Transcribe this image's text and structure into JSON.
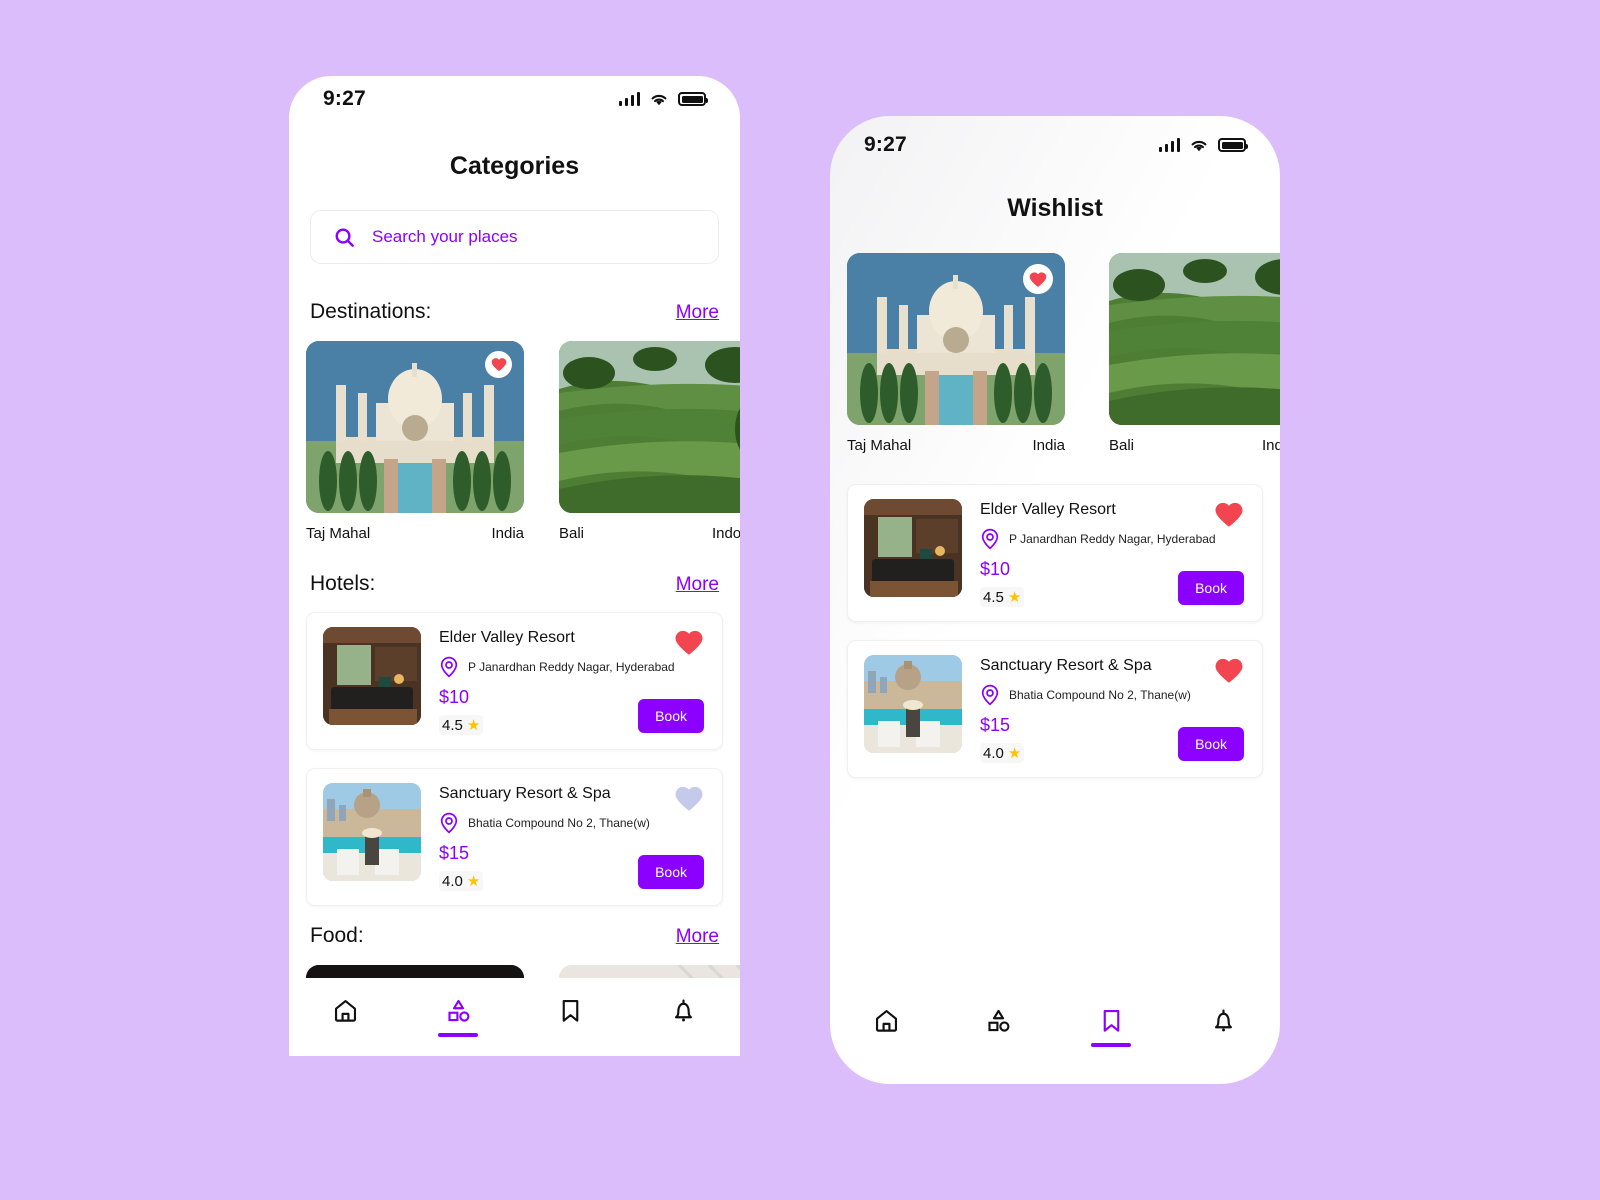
{
  "theme": {
    "background": "#dcbdfc",
    "accent": "#8b00ff",
    "heart_active": "#f2454f",
    "heart_inactive": "#c5c9ea",
    "star": "#ffc400",
    "text": "#111111"
  },
  "phone_left": {
    "status_bar": {
      "time": "9:27",
      "signal_icon": "signal-bars-icon",
      "wifi_icon": "wifi-icon",
      "battery_icon": "battery-icon"
    },
    "title": "Categories",
    "search": {
      "icon": "search-icon",
      "placeholder": "Search your places",
      "value": ""
    },
    "sections": [
      {
        "title": "Destinations:",
        "more_label": "More"
      },
      {
        "title": "Hotels:",
        "more_label": "More"
      },
      {
        "title": "Food:",
        "more_label": "More"
      }
    ],
    "destinations": [
      {
        "name": "Taj Mahal",
        "country": "India",
        "favorite": true,
        "image": "taj-mahal-photo"
      },
      {
        "name": "Bali",
        "country": "Indonesia",
        "favorite": false,
        "image": "bali-rice-terrace-photo"
      }
    ],
    "hotels": [
      {
        "name": "Elder Valley Resort",
        "location_icon": "location-pin-icon",
        "location": "P Janardhan Reddy Nagar, Hyderabad",
        "price": "$10",
        "rating": "4.5",
        "star_icon": "star-icon",
        "favorite": true,
        "book_label": "Book",
        "image": "hotel-bedroom-photo"
      },
      {
        "name": "Sanctuary Resort & Spa",
        "location_icon": "location-pin-icon",
        "location": "Bhatia Compound No 2, Thane(w)",
        "price": "$15",
        "rating": "4.0",
        "star_icon": "star-icon",
        "favorite": false,
        "book_label": "Book",
        "image": "rooftop-pool-photo"
      }
    ],
    "food": [
      {
        "image": "dark-plated-dish-photo"
      },
      {
        "image": "fresh-salad-bowl-photo"
      }
    ],
    "nav": [
      {
        "icon": "home-icon",
        "active": false
      },
      {
        "icon": "categories-icon",
        "active": true
      },
      {
        "icon": "bookmark-icon",
        "active": false
      },
      {
        "icon": "bell-icon",
        "active": false
      }
    ]
  },
  "phone_right": {
    "status_bar": {
      "time": "9:27",
      "signal_icon": "signal-bars-icon",
      "wifi_icon": "wifi-icon",
      "battery_icon": "battery-icon"
    },
    "title": "Wishlist",
    "destinations": [
      {
        "name": "Taj Mahal",
        "country": "India",
        "favorite": true,
        "image": "taj-mahal-photo"
      },
      {
        "name": "Bali",
        "country": "Indonesia",
        "favorite": false,
        "image": "bali-rice-terrace-photo"
      }
    ],
    "hotels": [
      {
        "name": "Elder Valley Resort",
        "location_icon": "location-pin-icon",
        "location": "P Janardhan Reddy Nagar, Hyderabad",
        "price": "$10",
        "rating": "4.5",
        "star_icon": "star-icon",
        "favorite": true,
        "book_label": "Book",
        "image": "hotel-bedroom-photo"
      },
      {
        "name": "Sanctuary Resort & Spa",
        "location_icon": "location-pin-icon",
        "location": "Bhatia Compound No 2, Thane(w)",
        "price": "$15",
        "rating": "4.0",
        "star_icon": "star-icon",
        "favorite": true,
        "book_label": "Book",
        "image": "rooftop-pool-photo"
      }
    ],
    "nav": [
      {
        "icon": "home-icon",
        "active": false
      },
      {
        "icon": "categories-icon",
        "active": false
      },
      {
        "icon": "bookmark-icon",
        "active": true
      },
      {
        "icon": "bell-icon",
        "active": false
      }
    ]
  }
}
